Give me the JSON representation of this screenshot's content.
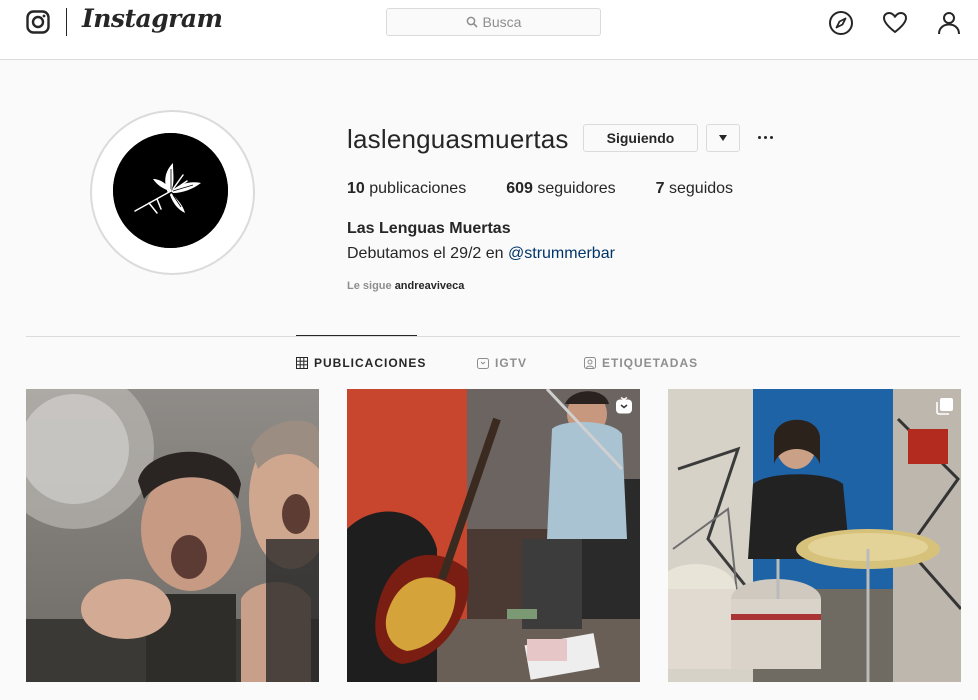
{
  "nav": {
    "brand": "Instagram",
    "search_placeholder": "Busca",
    "icons": [
      "instagram-glyph-icon",
      "compass-icon",
      "heart-icon",
      "profile-icon"
    ]
  },
  "profile": {
    "username": "laslenguasmuertas",
    "follow_button": "Siguiendo",
    "stats": {
      "posts_count": "10",
      "posts_label": "publicaciones",
      "followers_count": "609",
      "followers_label": "seguidores",
      "following_count": "7",
      "following_label": "seguidos"
    },
    "full_name": "Las Lenguas Muertas",
    "bio_text": "Debutamos el 29/2 en ",
    "bio_mention": "@strummerbar",
    "followed_by_label": "Le sigue",
    "followed_by_user": "andreaviveca"
  },
  "tabs": [
    {
      "label": "PUBLICACIONES",
      "icon": "grid-icon",
      "active": true
    },
    {
      "label": "IGTV",
      "icon": "igtv-icon",
      "active": false
    },
    {
      "label": "ETIQUETADAS",
      "icon": "tagged-icon",
      "active": false
    }
  ],
  "posts": [
    {
      "description": "photo",
      "badge": null
    },
    {
      "description": "photo",
      "badge": "igtv-icon"
    },
    {
      "description": "photo",
      "badge": "carousel-icon"
    }
  ],
  "colors": {
    "background": "#fafafa",
    "border": "#dbdbdb",
    "text": "#262626",
    "muted": "#8e8e8e",
    "link": "#003569"
  }
}
